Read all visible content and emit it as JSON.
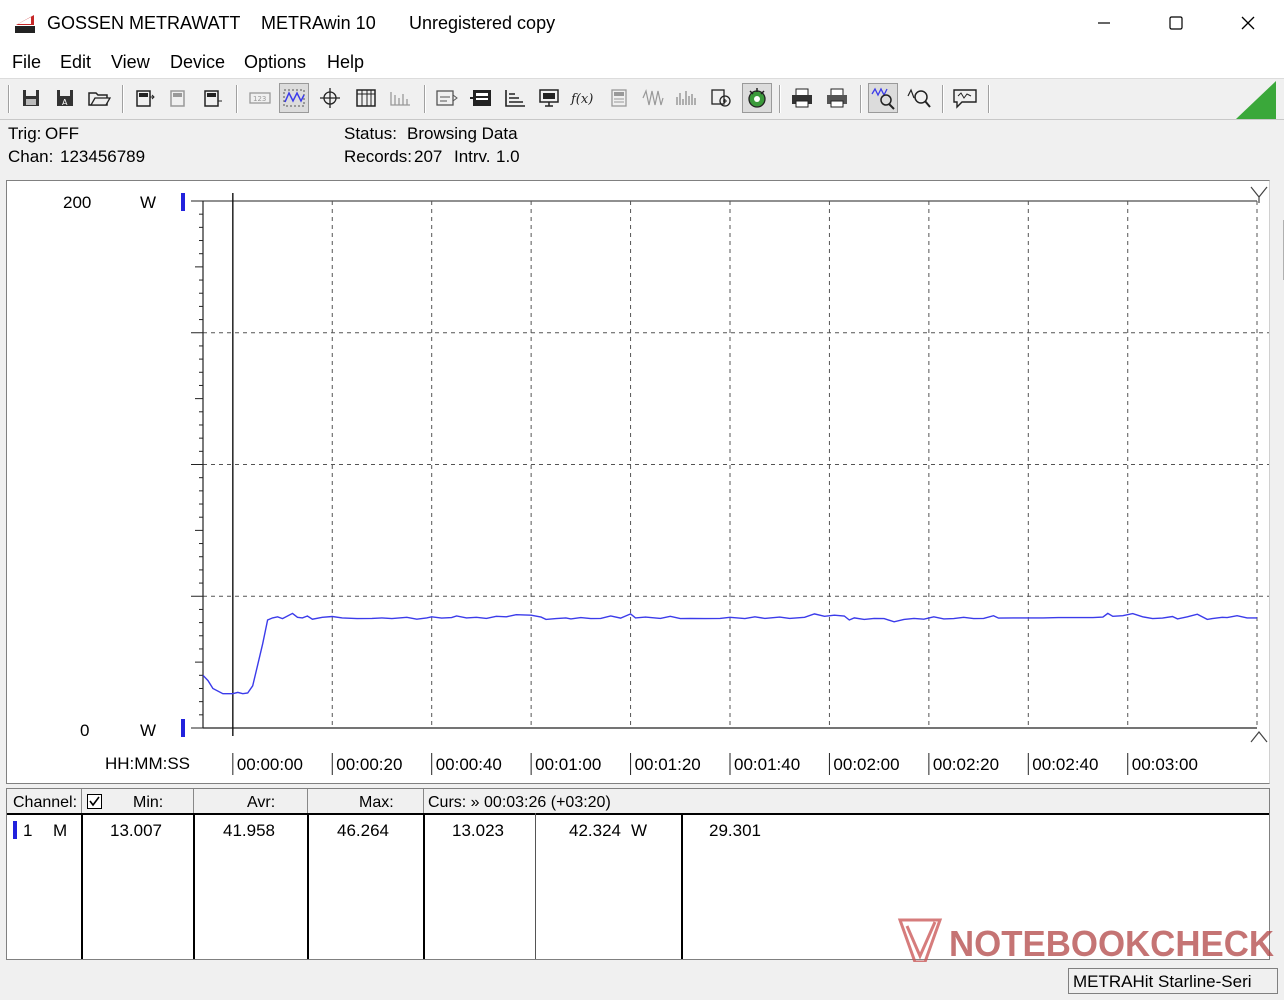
{
  "titlebar": {
    "brand": "GOSSEN METRAWATT",
    "app": "METRAwin 10",
    "registration": "Unregistered copy",
    "icons": [
      "app-icon",
      "minimize-icon",
      "maximize-icon",
      "close-icon"
    ]
  },
  "menu": [
    "File",
    "Edit",
    "View",
    "Device",
    "Options",
    "Help"
  ],
  "toolbar": {
    "buttons": [
      "save-icon",
      "save-as-icon",
      "open-folder-icon",
      "device-read-icon",
      "device-config-icon",
      "device-info-icon",
      "table-view-icon",
      "graph-view-icon",
      "crosshair-icon",
      "list-view-icon",
      "histogram-icon",
      "channel-setup-icon",
      "trigger-icon",
      "scale-icon",
      "monitor-icon",
      "formula-icon",
      "calc-icon",
      "wave-icon",
      "spectrum-icon",
      "export-icon",
      "online-icon",
      "print-icon",
      "print-setup-icon",
      "zoom-graph-icon",
      "zoom-in-icon",
      "comment-icon"
    ]
  },
  "info": {
    "trig_label": "Trig:",
    "trig_value": "OFF",
    "chan_label": "Chan:",
    "chan_value": "123456789",
    "status_label": "Status:",
    "status_value": "Browsing Data",
    "records_label": "Records:",
    "records_value": "207",
    "interval_label": "Intrv.",
    "interval_value": "1.0"
  },
  "chart_data": {
    "type": "line",
    "xlabel": "HH:MM:SS",
    "x_ticks": [
      "00:00:00",
      "00:00:20",
      "00:00:40",
      "00:01:00",
      "00:01:20",
      "00:01:40",
      "00:02:00",
      "00:02:20",
      "00:02:40",
      "00:03:00"
    ],
    "y_max_label": "200",
    "y_min_label": "0",
    "y_unit": "W",
    "ylim": [
      0,
      200
    ],
    "xlim_seconds": [
      -6,
      206
    ],
    "cursor_seconds": 0,
    "grid": true,
    "line_color": "#3b3bea",
    "series": [
      {
        "values": [
          [
            -6,
            20
          ],
          [
            -5,
            18
          ],
          [
            -4,
            15
          ],
          [
            -2,
            13
          ],
          [
            0,
            13
          ],
          [
            1,
            13.5
          ],
          [
            2,
            13
          ],
          [
            3,
            13.3
          ],
          [
            4,
            16
          ],
          [
            5,
            24
          ],
          [
            6,
            32
          ],
          [
            7,
            41
          ],
          [
            8,
            41.8
          ],
          [
            9,
            42.2
          ],
          [
            10,
            41.5
          ],
          [
            12,
            43.5
          ],
          [
            13,
            42
          ],
          [
            14,
            41.8
          ],
          [
            15,
            42.5
          ],
          [
            16,
            41.3
          ],
          [
            18,
            42
          ],
          [
            20,
            42.3
          ],
          [
            22,
            41.8
          ],
          [
            25,
            41.5
          ],
          [
            28,
            41.6
          ],
          [
            30,
            41.8
          ],
          [
            32,
            41.5
          ],
          [
            35,
            42
          ],
          [
            37,
            41.3
          ],
          [
            39,
            41.8
          ],
          [
            40,
            42.2
          ],
          [
            42,
            41.7
          ],
          [
            44,
            41.9
          ],
          [
            45,
            42.5
          ],
          [
            47,
            41.8
          ],
          [
            49,
            42
          ],
          [
            51,
            41.6
          ],
          [
            53,
            42.4
          ],
          [
            55,
            42.2
          ],
          [
            57,
            43
          ],
          [
            60,
            42.8
          ],
          [
            62,
            42.1
          ],
          [
            63,
            41.2
          ],
          [
            65,
            41.5
          ],
          [
            67,
            41.8
          ],
          [
            68,
            41.4
          ],
          [
            70,
            41.9
          ],
          [
            72,
            41.5
          ],
          [
            74,
            41.6
          ],
          [
            76,
            42.5
          ],
          [
            78,
            41.7
          ],
          [
            80,
            43.3
          ],
          [
            81,
            41.8
          ],
          [
            83,
            42.1
          ],
          [
            86,
            41.6
          ],
          [
            88,
            42.4
          ],
          [
            90,
            41.5
          ],
          [
            92,
            41.6
          ],
          [
            95,
            41.5
          ],
          [
            98,
            41.6
          ],
          [
            100,
            42
          ],
          [
            103,
            41.5
          ],
          [
            105,
            42.2
          ],
          [
            107,
            41.6
          ],
          [
            110,
            42.1
          ],
          [
            112,
            41.6
          ],
          [
            115,
            42
          ],
          [
            117,
            43.3
          ],
          [
            119,
            42.4
          ],
          [
            121,
            42.8
          ],
          [
            123,
            42.5
          ],
          [
            124,
            41
          ],
          [
            125,
            41.8
          ],
          [
            127,
            41.2
          ],
          [
            129,
            41.6
          ],
          [
            131,
            41.5
          ],
          [
            133,
            40.3
          ],
          [
            135,
            41.2
          ],
          [
            137,
            41.6
          ],
          [
            139,
            41.3
          ],
          [
            141,
            42.2
          ],
          [
            143,
            41.4
          ],
          [
            145,
            41.5
          ],
          [
            147,
            42
          ],
          [
            149,
            41.5
          ],
          [
            151,
            41.6
          ],
          [
            153,
            42.6
          ],
          [
            154,
            41.7
          ],
          [
            157,
            41.8
          ],
          [
            160,
            41.8
          ],
          [
            163,
            41.8
          ],
          [
            166,
            41.9
          ],
          [
            170,
            41.9
          ],
          [
            173,
            41.9
          ],
          [
            175,
            42.1
          ],
          [
            176,
            43.5
          ],
          [
            177,
            42.4
          ],
          [
            179,
            42.6
          ],
          [
            181,
            43.4
          ],
          [
            183,
            42.2
          ],
          [
            185,
            41.5
          ],
          [
            187,
            41.7
          ],
          [
            189,
            42.3
          ],
          [
            190,
            41.4
          ],
          [
            192,
            42.2
          ],
          [
            194,
            43.2
          ],
          [
            196,
            41.2
          ],
          [
            197,
            41.5
          ],
          [
            199,
            42
          ],
          [
            200,
            41.9
          ],
          [
            202,
            42.6
          ],
          [
            204,
            41.8
          ],
          [
            206,
            41.8
          ]
        ]
      }
    ]
  },
  "table": {
    "headers": {
      "channel": "Channel:",
      "min": "Min:",
      "avg": "Avr:",
      "max": "Max:",
      "cursor": "Curs: » 00:03:26 (+03:20)"
    },
    "row": {
      "channel": "1",
      "mode": "M",
      "min": "13.007",
      "avg": "41.958",
      "max": "46.264",
      "curs1": "13.023",
      "curs2": "42.324",
      "unit": "W",
      "curs3": "29.301"
    }
  },
  "statusbar": {
    "device": "METRAHit Starline-Seri"
  },
  "watermark": {
    "text": "NOTEBOOKCHECK",
    "color": "#b04040"
  }
}
